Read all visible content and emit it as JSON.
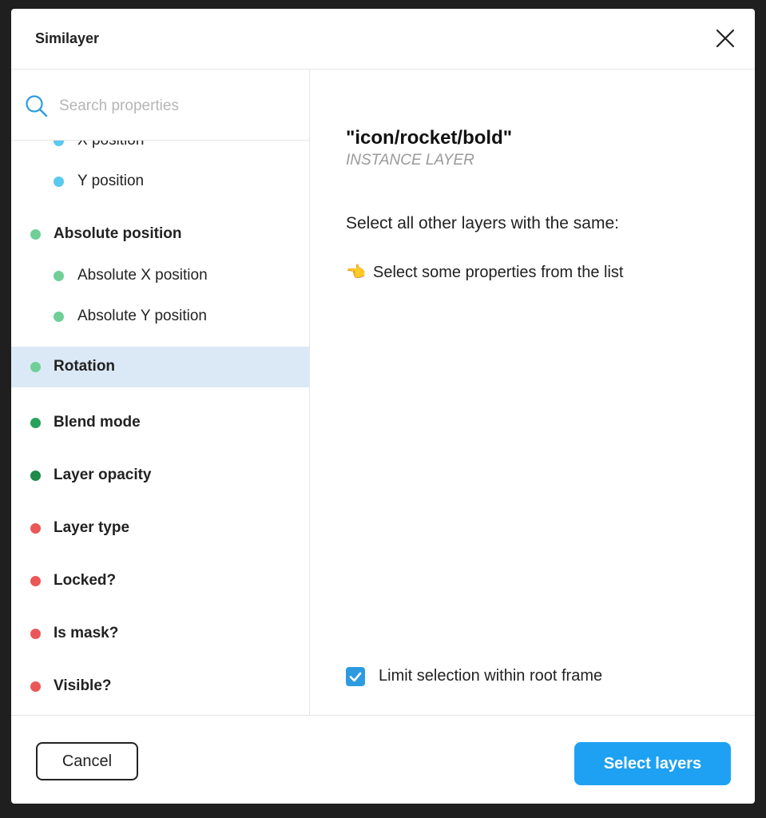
{
  "window": {
    "title": "Similayer"
  },
  "search": {
    "placeholder": "Search properties"
  },
  "properties": [
    {
      "label": "X position",
      "level": "child",
      "color": "#5bc8f0"
    },
    {
      "label": "Y position",
      "level": "child",
      "color": "#5bc8f0"
    },
    {
      "label": "Absolute position",
      "level": "parent",
      "color": "#6fcf97"
    },
    {
      "label": "Absolute X position",
      "level": "child",
      "color": "#6fcf97"
    },
    {
      "label": "Absolute Y position",
      "level": "child",
      "color": "#6fcf97"
    },
    {
      "label": "Rotation",
      "level": "parent",
      "color": "#6fcf97",
      "selected": true
    },
    {
      "label": "Blend mode",
      "level": "parent",
      "color": "#27a25a"
    },
    {
      "label": "Layer opacity",
      "level": "parent",
      "color": "#1e8a4c"
    },
    {
      "label": "Layer type",
      "level": "parent",
      "color": "#eb5757"
    },
    {
      "label": "Locked?",
      "level": "parent",
      "color": "#eb5757"
    },
    {
      "label": "Is mask?",
      "level": "parent",
      "color": "#eb5757"
    },
    {
      "label": "Visible?",
      "level": "parent",
      "color": "#eb5757"
    }
  ],
  "main": {
    "layer_name": "\"icon/rocket/bold\"",
    "layer_type": "INSTANCE LAYER",
    "heading": "Select all other layers with the same:",
    "hint_icon": "👈",
    "hint": "Select some properties from the list",
    "limit_checkbox": {
      "label": "Limit selection within root frame",
      "checked": true
    }
  },
  "footer": {
    "cancel_label": "Cancel",
    "primary_label": "Select layers"
  },
  "colors": {
    "accent": "#1ea1f2",
    "selected_row": "#dbe9f6"
  }
}
